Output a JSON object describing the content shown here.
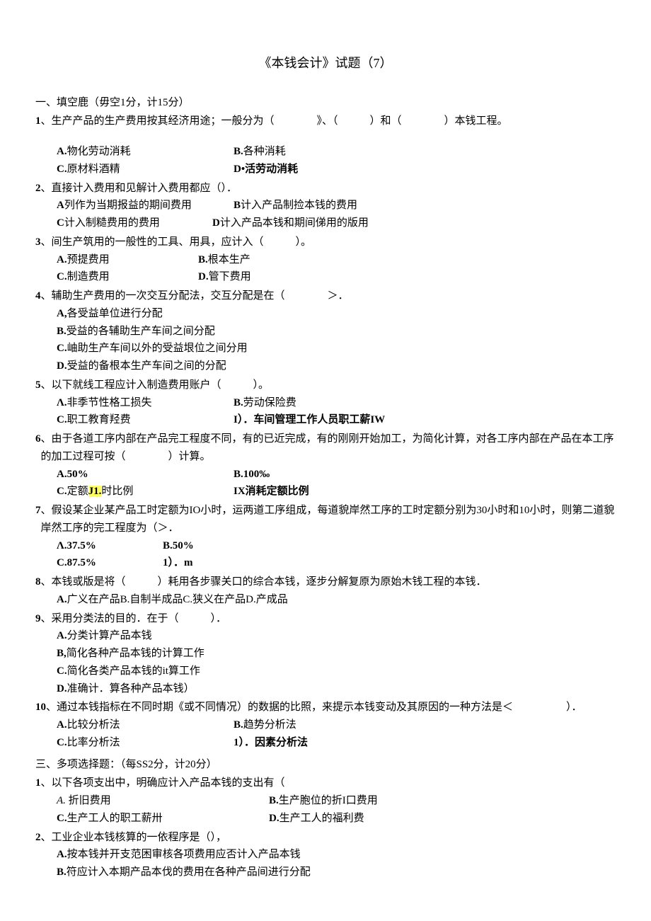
{
  "title": "《本钱会计》试题（7）",
  "section1_header": "一、填空鹿（毋空1分，计15分）",
  "q1": {
    "num": "1",
    "text": "、生产产品的生产费用按其经济用途；一般分为（　　　　》、（　　　）和（　　　　）本钱工程。",
    "a": "物化劳动消耗",
    "b": "各种消耗",
    "c": "原材料酒精",
    "d": "D•活劳动消耗"
  },
  "q2": {
    "num": "2",
    "text": "、直接计入费用和见解计入费用都应（）．",
    "a": "列作为当期报益的期间费用",
    "b": "计入产品制捡本钱的费用",
    "c": "计入制糙费用的费用",
    "d": "计入产品本钱和期间俤用的版用"
  },
  "q3": {
    "num": "3",
    "text": "、间生产筑用的一般性的工具、用具，应计入（　　　）。",
    "a": "预提费用",
    "b": "根本生产",
    "c": "制造费用",
    "d": "管下费用"
  },
  "q4": {
    "num": "4",
    "text": "、辅助生产费用的一次交互分配法，交互分配是在（　　　　＞．",
    "a": "各受益单位进行分配",
    "b": "受益的各辅助生产车间之间分配",
    "c": "岫助生产车间以外的受益垠位之间分用",
    "d": "受益的备根本生产车间之间的分配"
  },
  "q5": {
    "num": "5",
    "text": "、以下就线工程应计入制造费用账户（　　　）。",
    "a": "非季节性格工损失",
    "b": "劳动保险费",
    "c": "职工教育羟费",
    "d": "I）．车间管理工作人员职工薪IW"
  },
  "q6": {
    "num": "6",
    "text": "、由于各道工序内部在产品完工程度不同，有的已近完成，有的刚刚开始加工，为简化计算，对各工序内部在产品在本工序的加工过程可按（　　　　）计算。",
    "a": "A.50%",
    "b": "B.100‰",
    "c_pre": "C.",
    "c_text1": "定额",
    "c_hl": "J1.",
    "c_text2": "时比例",
    "d": "IX消耗定额比例"
  },
  "q7": {
    "num": "7",
    "text": "、假设某企业某产品工时定额为IO小时，运两道工序组成，每道貌岸然工序的工时定额分别为30小时和10小时，则第二道貌岸然工序的完工程度为（＞．",
    "a": "Λ.37.5%",
    "b": "B.50%",
    "c": "C.87.5%",
    "d": "1）．m"
  },
  "q8": {
    "num": "8",
    "text": "、本钱或版是将（　　　）耗用各步骤关口的综合本钱，逐步分解复原为原始木钱工程的本钱．",
    "options": "广义在产品B.自制半成品C.狭义在产品D.产成品"
  },
  "q9": {
    "num": "9",
    "text": "、采用分类法的目的．在于（　　　）．",
    "a": "分类计算产品本钱",
    "b": "简化各种产品本钱的计算工作",
    "c": "简化各类产品本钱的it算工作",
    "d": "准确计．算各种产品本钱）"
  },
  "q10": {
    "num": "10",
    "text": "、通过本钱指标在不同时期《或不同情况）的数据的比照，来提示本钱变动及其原因的一种方法是＜　　　　　）．",
    "a": "比较分析法",
    "b": "趋势分析法",
    "c": "比率分析法",
    "d": "1）．因素分析法"
  },
  "section3_header": "三、多项选择题：（每SS2分，计20分）",
  "mq1": {
    "num": "1",
    "text": "、以下各项支出中，明确应计入产品本钱的支出有（",
    "a": "折旧费用",
    "b": "生产胞位的折I口费用",
    "c": "生产工人的职工薪卅",
    "d": "生产工人的福利费"
  },
  "mq2": {
    "num": "2",
    "text": "、工业企业本钱核算的一依程序是（），",
    "a": "按本钱并开支范困审核各项费用应否计入产品本钱",
    "b": "符应计入本期产品本伐的费用在各种产品间进行分配"
  }
}
